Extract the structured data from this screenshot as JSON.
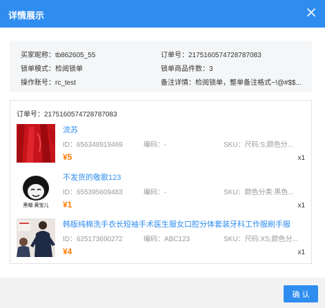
{
  "dialog": {
    "title": "详情展示",
    "confirm_label": "确 认"
  },
  "summary": {
    "buyer_label": "买家昵称：",
    "buyer_value": "tb862605_55",
    "order_label": "订单号：",
    "order_value": "2175160574728787083",
    "lock_mode_label": "锁单模式：",
    "lock_mode_value": "检阅锁单",
    "lock_count_label": "锁单商品件数：",
    "lock_count_value": "3",
    "operator_label": "操作账号：",
    "operator_value": "rc_test",
    "remark_label": "备注详情：",
    "remark_value": "检阅锁单，整单备注格式~!@#$$..."
  },
  "order": {
    "label": "订单号：",
    "value": "2175160574728787083",
    "items": [
      {
        "title": "流苏",
        "id_label": "ID：",
        "id": "656348919469",
        "code_label": "编码：",
        "code": "-",
        "sku_label": "SKU：",
        "sku": "尺码:S;颜色分...",
        "price": "¥5",
        "qty": "x1"
      },
      {
        "title": "不发货的敬歌123",
        "id_label": "ID：",
        "id": "655395609483",
        "code_label": "编码：",
        "code": "-",
        "sku_label": "SKU：",
        "sku": "颜色分类:黑色...",
        "price": "¥1",
        "qty": "x1",
        "thumb_caption": "黑帽 黄宝儿"
      },
      {
        "title": "韩版纯棉洗手衣长短袖手术医生服女口腔分体套装牙科工作服刷手服",
        "id_label": "ID：",
        "id": "625173690272",
        "code_label": "编码：",
        "code": "ABC123",
        "sku_label": "SKU：",
        "sku": "尺码:XS;颜色分...",
        "price": "¥4",
        "qty": "x1"
      }
    ]
  },
  "colors": {
    "primary": "#2f8df0",
    "price": "#ff7a00"
  },
  "icons": {
    "close": "close-icon"
  }
}
